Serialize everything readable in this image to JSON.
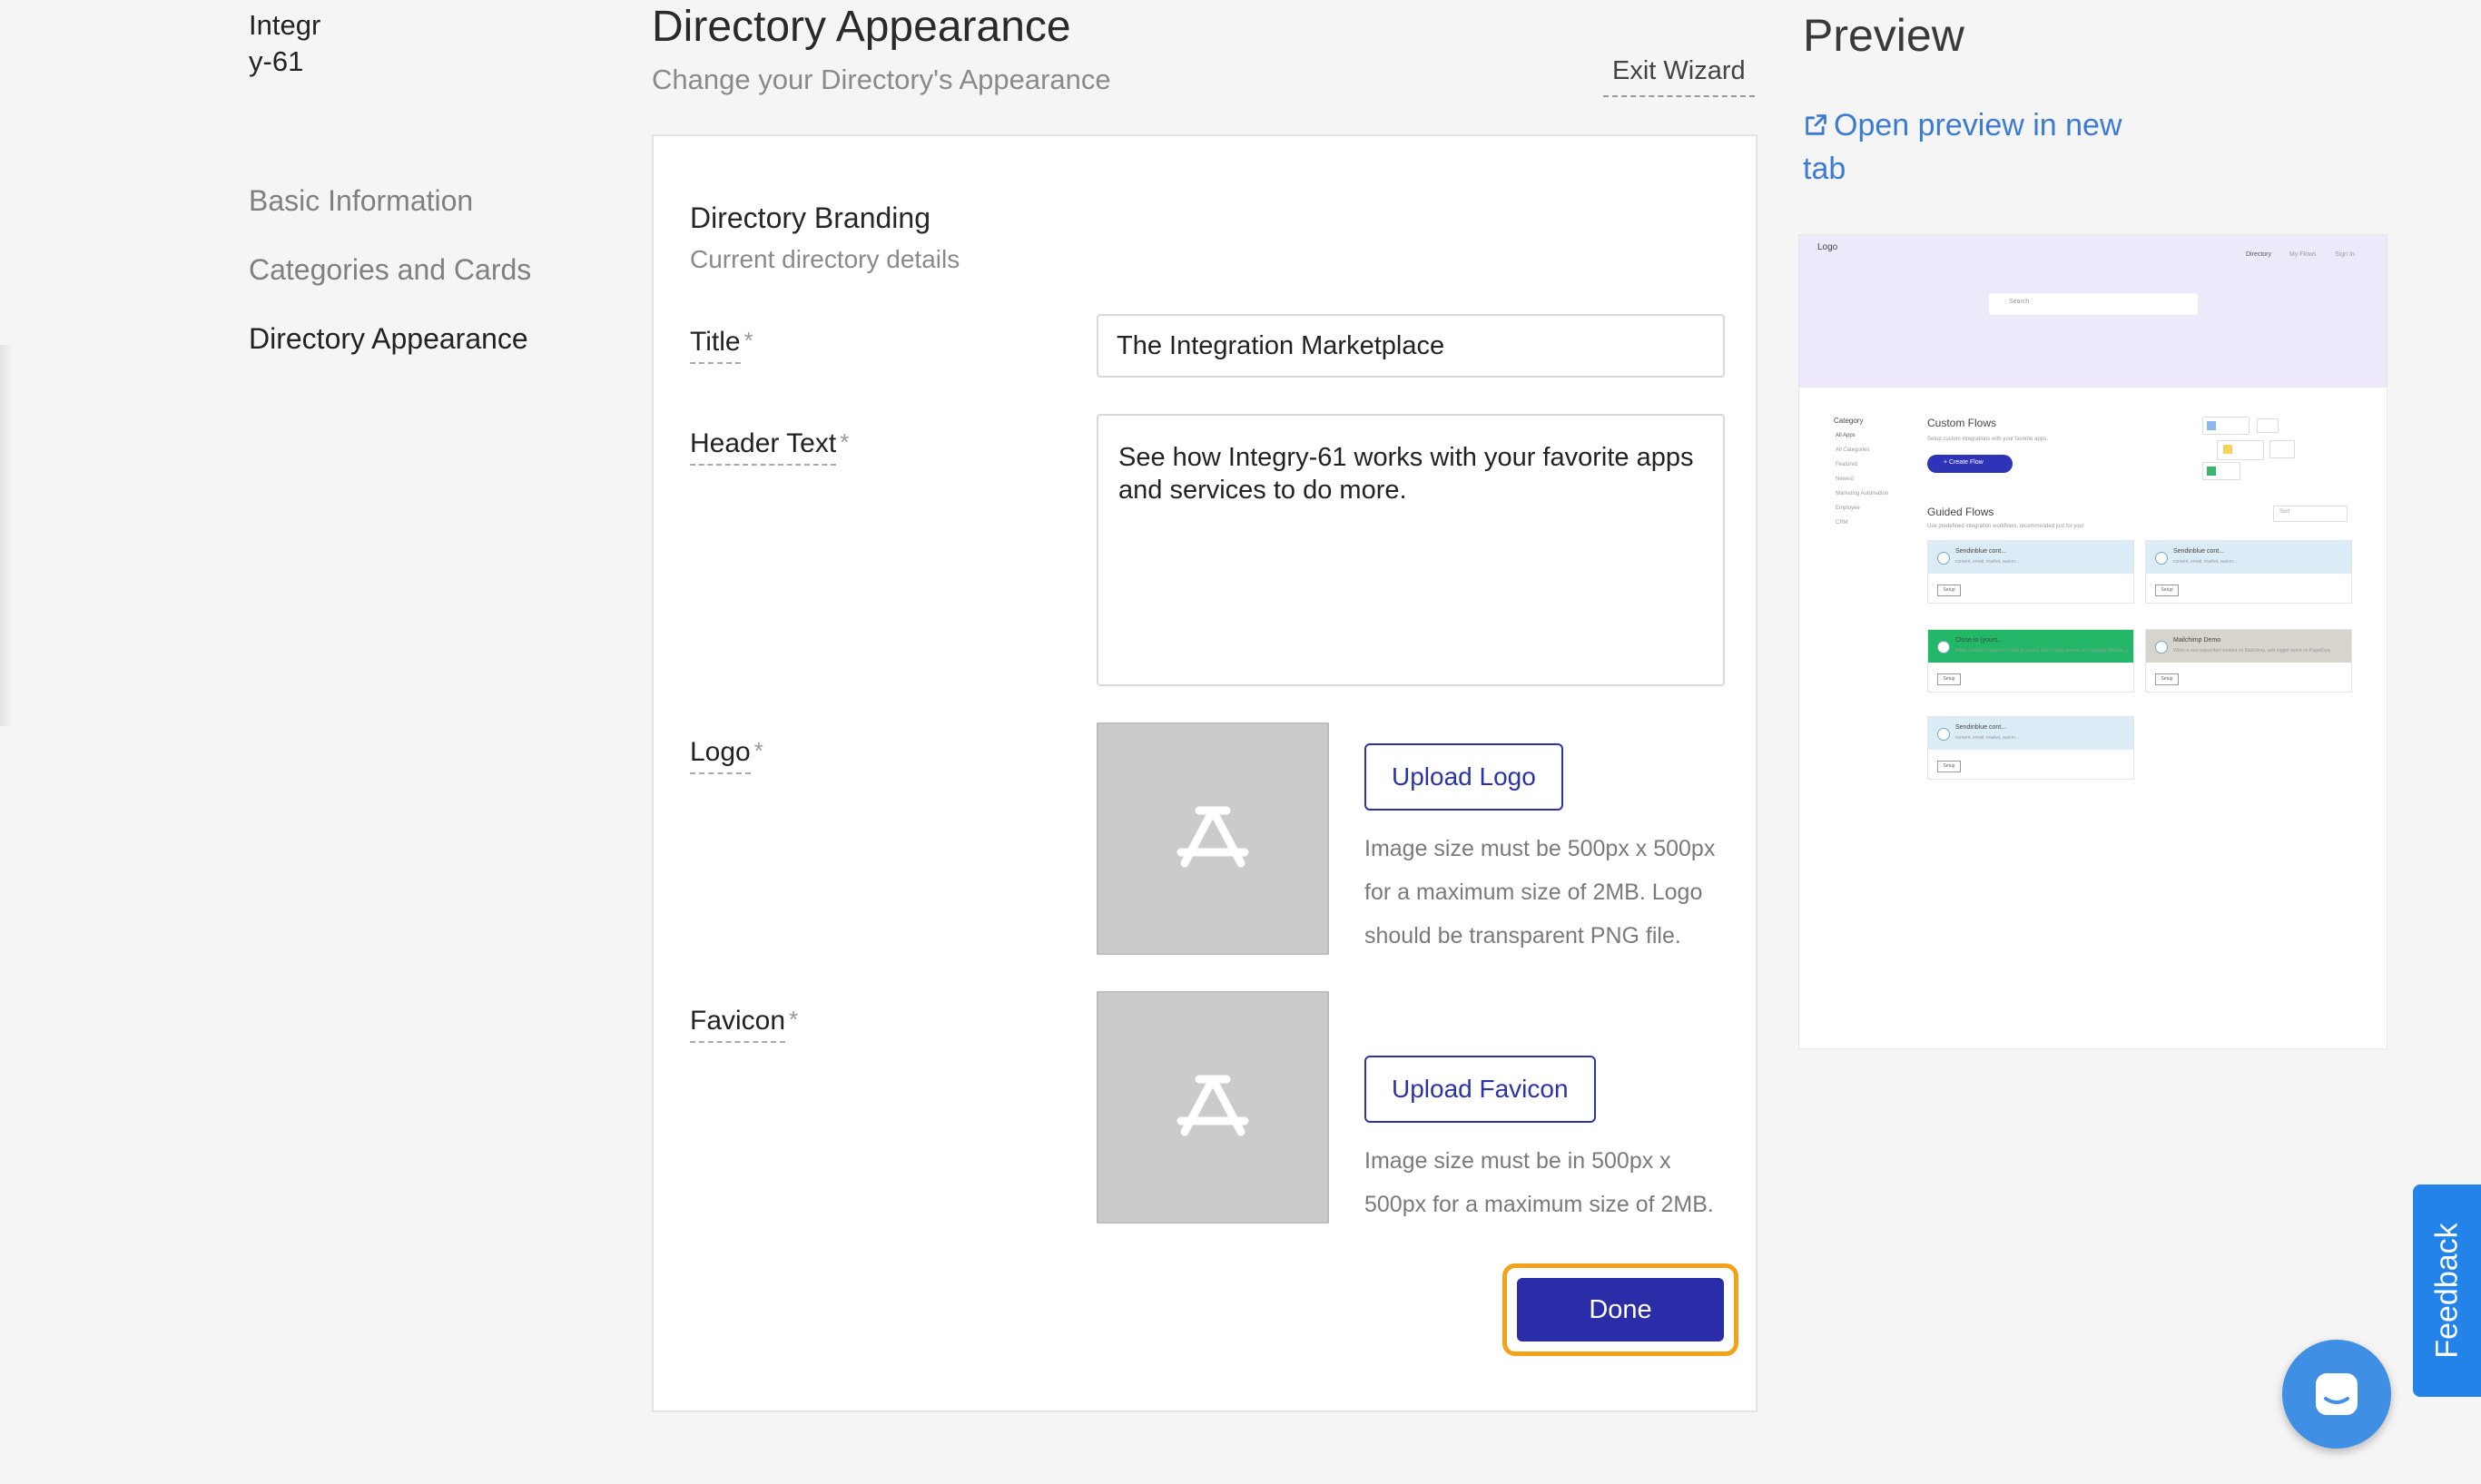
{
  "org": {
    "name_line1": "Integr",
    "name_line2": "y-61"
  },
  "sidebar": {
    "items": [
      {
        "label": "Basic Information"
      },
      {
        "label": "Categories and Cards"
      },
      {
        "label": "Directory Appearance"
      }
    ]
  },
  "header": {
    "title": "Directory Appearance",
    "subtitle": "Change your Directory's Appearance",
    "exit_label": "Exit Wizard"
  },
  "form": {
    "section_title": "Directory Branding",
    "section_subtitle": "Current directory details",
    "required_mark": "*",
    "title_label": "Title",
    "title_value": "The Integration Marketplace",
    "header_text_label": "Header Text",
    "header_text_value": "See how Integry-61 works with your favorite apps and services to do more.",
    "logo_label": "Logo",
    "upload_logo_label": "Upload Logo",
    "logo_hint": "Image size must be 500px x 500px for a maximum size of 2MB. Logo should be transparent PNG file.",
    "favicon_label": "Favicon",
    "upload_favicon_label": "Upload Favicon",
    "favicon_hint": "Image size must be in 500px x 500px for a maximum size of 2MB.",
    "done_label": "Done"
  },
  "preview": {
    "title": "Preview",
    "open_link_label": "Open preview in new tab",
    "thumb": {
      "logo": "Logo",
      "nav": [
        "Directory",
        "My Flows",
        "Sign In"
      ],
      "search_placeholder": "Search",
      "sidebar_heading": "Category",
      "categories": [
        "All Apps",
        "All Categories",
        "Featured",
        "Newest",
        "Marketing Automation",
        "Employee",
        "CRM"
      ],
      "custom_flows_title": "Custom Flows",
      "custom_flows_sub": "Setup custom integrations with your favorite apps.",
      "create_flow_label": "+ Create Flow",
      "guided_flows_title": "Guided Flows",
      "guided_flows_sub": "Use predefined integration workflows, recommended just for you!",
      "sort_label": "Sort",
      "cards": [
        {
          "title": "Sendinblue cont...",
          "sub": "content, email, market, autom...",
          "button": "Setup",
          "color": "#dcecf7"
        },
        {
          "title": "Sendinblue cont...",
          "sub": "content, email, market, autom...",
          "button": "Setup",
          "color": "#dcecf7"
        },
        {
          "title": "Close.io (yours...",
          "sub": "When Contact Created in Close.io (yours) then Create person on Campaign Monitor (yours)",
          "button": "Setup",
          "color": "#22b868"
        },
        {
          "title": "Mailchimp Demo",
          "sub": "When a new subscriber created on Mailchimp, add trigger event on PagerDuty",
          "button": "Setup",
          "color": "#d7d4ce"
        },
        {
          "title": "Sendinblue cont...",
          "sub": "content, email, market, autom...",
          "button": "Setup",
          "color": "#dcecf7"
        }
      ]
    }
  },
  "feedback": {
    "label": "Feedback"
  },
  "icons": {
    "external_link": "external-link-icon",
    "placeholder": "app-placeholder-icon",
    "chat": "chat-icon"
  },
  "colors": {
    "primary": "#2a2ca8",
    "focus_ring": "#f2a31b",
    "link": "#3b7bd4",
    "feedback": "#2483e8"
  }
}
